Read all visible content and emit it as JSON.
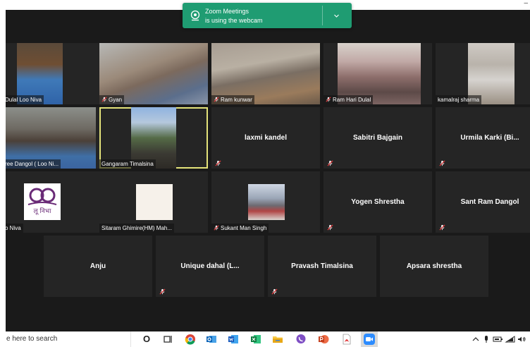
{
  "notification": {
    "title": "Zoom Meetings",
    "subtitle": "is using the webcam"
  },
  "participants": [
    {
      "name": "Dulal Loo Niva"
    },
    {
      "name": "Gyan"
    },
    {
      "name": "Ram kunwar"
    },
    {
      "name": "Ram Hari Dulal"
    },
    {
      "name": "kamalraj sharma"
    },
    {
      "name": "ree Dangol ( Loo Ni..."
    },
    {
      "name": "Gangaram Timalsina"
    },
    {
      "name": "laxmi kandel"
    },
    {
      "name": "Sabitri Bajgain"
    },
    {
      "name": "Urmila  Karki (Bi..."
    },
    {
      "name": "o Niva"
    },
    {
      "name": "Sitaram Ghimire(HM) Mah..."
    },
    {
      "name": "Sukant Man Singh"
    },
    {
      "name": "Yogen Shrestha"
    },
    {
      "name": "Sant Ram Dangol"
    },
    {
      "name": "Anju"
    },
    {
      "name": "Unique  dahal  (L..."
    },
    {
      "name": "Pravash Timalsina"
    },
    {
      "name": "Apsara shrestha"
    }
  ],
  "logo_text": "लू निभा",
  "taskbar": {
    "search_placeholder": "e here to search",
    "cortana_glyph": "O"
  },
  "colors": {
    "notification": "#1f9c72",
    "active_speaker": "#e4e37a",
    "mic_muted": "#e0383b",
    "tile_bg": "#252525"
  }
}
